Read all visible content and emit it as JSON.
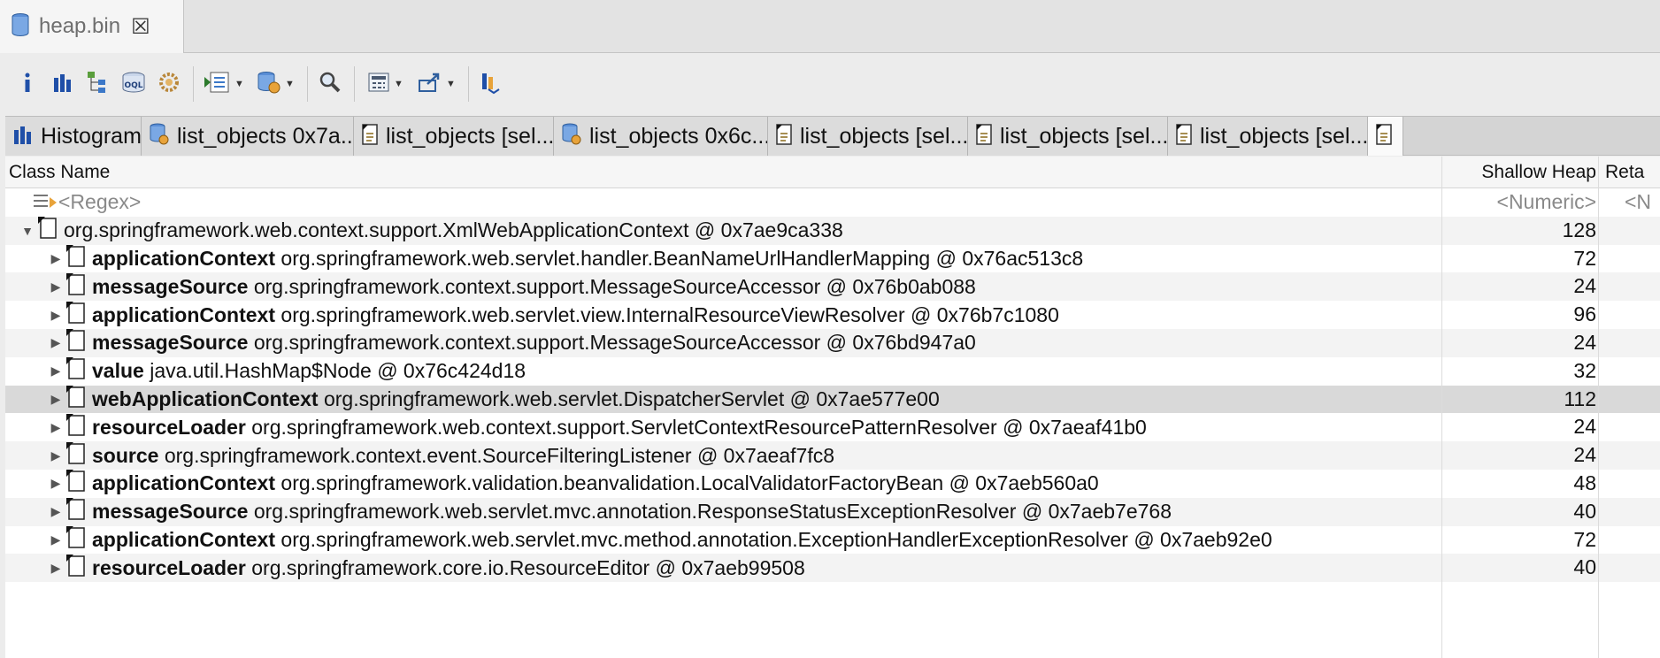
{
  "editor_tab": {
    "title": "heap.bin",
    "icon": "heap-database-icon",
    "close_icon": "close-icon"
  },
  "toolbar": {
    "items": [
      {
        "icon": "info-icon",
        "dropdown": false
      },
      {
        "icon": "histogram-icon",
        "dropdown": false
      },
      {
        "icon": "dominator-tree-icon",
        "dropdown": false
      },
      {
        "icon": "oql-icon",
        "dropdown": false
      },
      {
        "icon": "thread-overview-icon",
        "dropdown": false
      },
      {
        "icon": "run-report-icon",
        "dropdown": true
      },
      {
        "icon": "query-browser-icon",
        "dropdown": true
      },
      {
        "icon": "find-object-icon",
        "dropdown": false
      },
      {
        "icon": "calculator-icon",
        "dropdown": true
      },
      {
        "icon": "export-icon",
        "dropdown": true
      },
      {
        "icon": "heap-dump-compare-icon",
        "dropdown": false
      }
    ]
  },
  "result_tabs": [
    {
      "label": "Histogram",
      "icon": "histogram-icon"
    },
    {
      "label": "list_objects 0x7a...",
      "icon": "query-icon"
    },
    {
      "label": "list_objects [sel...",
      "icon": "object-list-icon"
    },
    {
      "label": "list_objects 0x6c...",
      "icon": "query-icon"
    },
    {
      "label": "list_objects [sel...",
      "icon": "object-list-icon"
    },
    {
      "label": "list_objects [sel...",
      "icon": "object-list-icon"
    },
    {
      "label": "list_objects [sel...",
      "icon": "object-list-icon"
    },
    {
      "label": "",
      "icon": "object-list-icon"
    }
  ],
  "table": {
    "columns": {
      "class_name": "Class Name",
      "shallow_heap": "Shallow Heap",
      "retained_heap": "Reta"
    },
    "filter": {
      "regex": "<Regex>",
      "numeric": "<Numeric>",
      "numeric_retained": "<N"
    },
    "root": {
      "name": "org.springframework.web.context.support.XmlWebApplicationContext @ 0x7ae9ca338",
      "shallow": "128"
    },
    "rows": [
      {
        "field": "applicationContext",
        "type": "org.springframework.web.servlet.handler.BeanNameUrlHandlerMapping @ 0x76ac513c8",
        "shallow": "72"
      },
      {
        "field": "messageSource",
        "type": "org.springframework.context.support.MessageSourceAccessor @ 0x76b0ab088",
        "shallow": "24"
      },
      {
        "field": "applicationContext",
        "type": "org.springframework.web.servlet.view.InternalResourceViewResolver @ 0x76b7c1080",
        "shallow": "96"
      },
      {
        "field": "messageSource",
        "type": "org.springframework.context.support.MessageSourceAccessor @ 0x76bd947a0",
        "shallow": "24"
      },
      {
        "field": "value",
        "type": "java.util.HashMap$Node @ 0x76c424d18",
        "shallow": "32"
      },
      {
        "field": "webApplicationContext",
        "type": "org.springframework.web.servlet.DispatcherServlet @ 0x7ae577e00",
        "shallow": "112"
      },
      {
        "field": "resourceLoader",
        "type": "org.springframework.web.context.support.ServletContextResourcePatternResolver @ 0x7aeaf41b0",
        "shallow": "24"
      },
      {
        "field": "source",
        "type": "org.springframework.context.event.SourceFilteringListener @ 0x7aeaf7fc8",
        "shallow": "24"
      },
      {
        "field": "applicationContext",
        "type": "org.springframework.validation.beanvalidation.LocalValidatorFactoryBean @ 0x7aeb560a0",
        "shallow": "48"
      },
      {
        "field": "messageSource",
        "type": "org.springframework.web.servlet.mvc.annotation.ResponseStatusExceptionResolver @ 0x7aeb7e768",
        "shallow": "40"
      },
      {
        "field": "applicationContext",
        "type": "org.springframework.web.servlet.mvc.method.annotation.ExceptionHandlerExceptionResolver @ 0x7aeb92e0",
        "shallow": "72"
      },
      {
        "field": "resourceLoader",
        "type": "org.springframework.core.io.ResourceEditor @ 0x7aeb99508",
        "shallow": "40"
      }
    ],
    "selected_row": 5
  }
}
